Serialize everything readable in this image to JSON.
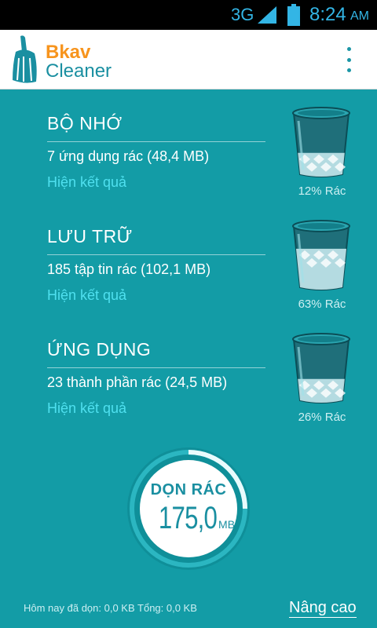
{
  "status_bar": {
    "network": "3G",
    "time": "8:24",
    "ampm": "AM"
  },
  "header": {
    "brand": "Bkav",
    "product": "Cleaner"
  },
  "sections": [
    {
      "title": "BỘ NHỚ",
      "detail": "7 ứng dụng rác (48,4 MB)",
      "link": "Hiện kết quả",
      "percent_label": "12% Rác",
      "fill": 0.12
    },
    {
      "title": "LƯU TRỮ",
      "detail": "185 tập tin rác (102,1 MB)",
      "link": "Hiện kết quả",
      "percent_label": "63% Rác",
      "fill": 0.63
    },
    {
      "title": "ỨNG DỤNG",
      "detail": "23 thành phần rác (24,5 MB)",
      "link": "Hiện kết quả",
      "percent_label": "26% Rác",
      "fill": 0.26
    }
  ],
  "clean_button": {
    "label": "DỌN RÁC",
    "size": "175,0",
    "unit": "MB"
  },
  "footer": {
    "stats": "Hôm nay đã dọn: 0,0 KB Tổng: 0,0 KB",
    "advanced": "Nâng cao"
  },
  "colors": {
    "background": "#139ca6",
    "accent_orange": "#f7941d",
    "accent_teal": "#1a8fa1",
    "link_cyan": "#4fe0ef"
  },
  "icons": {
    "logo": "broom-icon",
    "menu": "overflow-menu-icon",
    "bin": "trash-bin-icon"
  }
}
